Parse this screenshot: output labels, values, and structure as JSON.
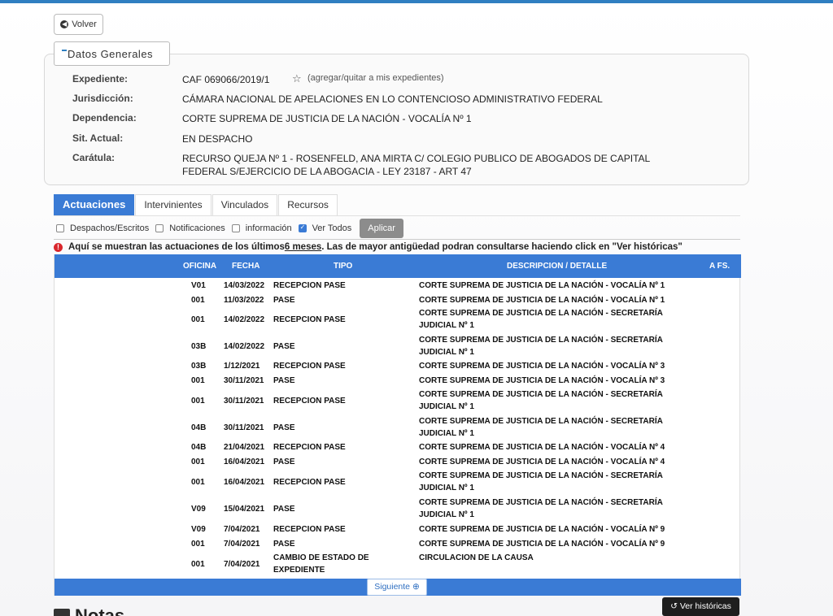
{
  "header": {
    "back_label": "Volver"
  },
  "datos": {
    "legend": "Datos Generales",
    "fields": [
      {
        "label": "Expediente:",
        "value": "CAF 069066/2019/1"
      },
      {
        "label": "Jurisdicción:",
        "value": "CÁMARA NACIONAL DE APELACIONES EN LO CONTENCIOSO ADMINISTRATIVO FEDERAL"
      },
      {
        "label": "Dependencia:",
        "value": "CORTE SUPREMA DE JUSTICIA DE LA NACIÓN - VOCALÍA Nº 1"
      },
      {
        "label": "Sit. Actual:",
        "value": "EN DESPACHO"
      },
      {
        "label": "Carátula:",
        "value": "RECURSO QUEJA Nº 1 - ROSENFELD, ANA MIRTA C/ COLEGIO PUBLICO DE ABOGADOS DE CAPITAL FEDERAL S/EJERCICIO DE LA ABOGACIA - LEY 23187 - ART 47"
      }
    ],
    "fav_label": "(agregar/quitar a mis expedientes)"
  },
  "tabs": [
    "Actuaciones",
    "Intervinientes",
    "Vinculados",
    "Recursos"
  ],
  "filters": {
    "items": [
      {
        "label": "Despachos/Escritos",
        "checked": false
      },
      {
        "label": "Notificaciones",
        "checked": false
      },
      {
        "label": "información",
        "checked": false
      },
      {
        "label": "Ver Todos",
        "checked": true
      }
    ],
    "apply_label": "Aplicar"
  },
  "notice": {
    "before": "Aquí se muestran las actuaciones de los últimos ",
    "emph": "6 meses",
    "after": ". Las de mayor antigüedad podran consultarse haciendo click en \"Ver históricas\""
  },
  "table": {
    "headers": {
      "oficina": "OFICINA",
      "fecha": "FECHA",
      "tipo": "TIPO",
      "descripcion": "DESCRIPCION / DETALLE",
      "afs": "A FS."
    },
    "rows": [
      {
        "oficina": "V01",
        "fecha": "14/03/2022",
        "tipo": "RECEPCION PASE",
        "descripcion": "CORTE SUPREMA DE JUSTICIA DE LA NACIÓN - VOCALÍA Nº 1"
      },
      {
        "oficina": "001",
        "fecha": "11/03/2022",
        "tipo": "PASE",
        "descripcion": "CORTE SUPREMA DE JUSTICIA DE LA NACIÓN - VOCALÍA Nº 1"
      },
      {
        "oficina": "001",
        "fecha": "14/02/2022",
        "tipo": "RECEPCION PASE",
        "descripcion": "CORTE SUPREMA DE JUSTICIA DE LA NACIÓN - SECRETARÍA JUDICIAL Nº 1"
      },
      {
        "oficina": "03B",
        "fecha": "14/02/2022",
        "tipo": "PASE",
        "descripcion": "CORTE SUPREMA DE JUSTICIA DE LA NACIÓN - SECRETARÍA JUDICIAL Nº 1"
      },
      {
        "oficina": "03B",
        "fecha": "1/12/2021",
        "tipo": "RECEPCION PASE",
        "descripcion": "CORTE SUPREMA DE JUSTICIA DE LA NACIÓN - VOCALÍA Nº 3"
      },
      {
        "oficina": "001",
        "fecha": "30/11/2021",
        "tipo": "PASE",
        "descripcion": "CORTE SUPREMA DE JUSTICIA DE LA NACIÓN - VOCALÍA Nº 3"
      },
      {
        "oficina": "001",
        "fecha": "30/11/2021",
        "tipo": "RECEPCION PASE",
        "descripcion": "CORTE SUPREMA DE JUSTICIA DE LA NACIÓN - SECRETARÍA JUDICIAL Nº 1"
      },
      {
        "oficina": "04B",
        "fecha": "30/11/2021",
        "tipo": "PASE",
        "descripcion": "CORTE SUPREMA DE JUSTICIA DE LA NACIÓN - SECRETARÍA JUDICIAL Nº 1"
      },
      {
        "oficina": "04B",
        "fecha": "21/04/2021",
        "tipo": "RECEPCION PASE",
        "descripcion": "CORTE SUPREMA DE JUSTICIA DE LA NACIÓN - VOCALÍA Nº 4"
      },
      {
        "oficina": "001",
        "fecha": "16/04/2021",
        "tipo": "PASE",
        "descripcion": "CORTE SUPREMA DE JUSTICIA DE LA NACIÓN - VOCALÍA Nº 4"
      },
      {
        "oficina": "001",
        "fecha": "16/04/2021",
        "tipo": "RECEPCION PASE",
        "descripcion": "CORTE SUPREMA DE JUSTICIA DE LA NACIÓN - SECRETARÍA JUDICIAL Nº 1"
      },
      {
        "oficina": "V09",
        "fecha": "15/04/2021",
        "tipo": "PASE",
        "descripcion": "CORTE SUPREMA DE JUSTICIA DE LA NACIÓN - SECRETARÍA JUDICIAL Nº 1"
      },
      {
        "oficina": "V09",
        "fecha": "7/04/2021",
        "tipo": "RECEPCION PASE",
        "descripcion": "CORTE SUPREMA DE JUSTICIA DE LA NACIÓN - VOCALÍA Nº 9"
      },
      {
        "oficina": "001",
        "fecha": "7/04/2021",
        "tipo": "PASE",
        "descripcion": "CORTE SUPREMA DE JUSTICIA DE LA NACIÓN - VOCALÍA Nº 9"
      },
      {
        "oficina": "001",
        "fecha": "7/04/2021",
        "tipo": "CAMBIO DE ESTADO DE EXPEDIENTE",
        "descripcion": "CIRCULACION DE LA CAUSA"
      }
    ]
  },
  "pager": {
    "next_label": "Siguiente"
  },
  "historicas_label": "Ver históricas",
  "notas_title": "Notas",
  "colors": {
    "accent": "#3a7bd5",
    "topbar": "#2f7fc1",
    "alert": "#d9262c"
  },
  "icons": {
    "back": "circle-arrow-left-icon",
    "star": "star-outline-icon",
    "alert": "exclamation-circle-icon",
    "next": "circle-arrow-right-icon",
    "history": "history-icon",
    "notes": "notes-icon"
  }
}
